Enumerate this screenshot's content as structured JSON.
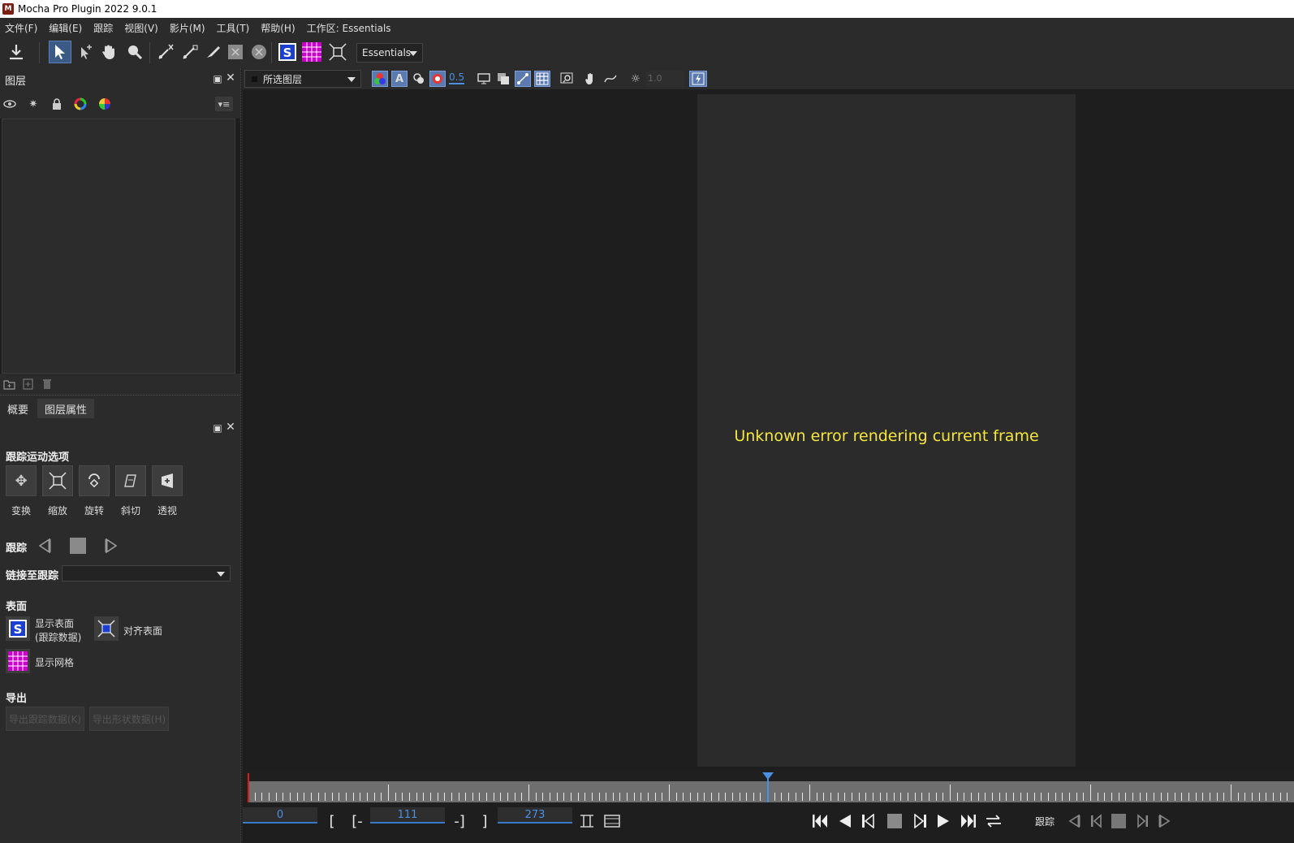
{
  "window": {
    "title": "Mocha Pro Plugin 2022 9.0.1",
    "app_icon_glyph": "M"
  },
  "menu": [
    "文件(F)",
    "编辑(E)",
    "跟踪",
    "视图(V)",
    "影片(M)",
    "工具(T)",
    "帮助(H)",
    "工作区: Essentials"
  ],
  "toolbar": {
    "workspace_value": "Essentials"
  },
  "layers_panel": {
    "title": "图层"
  },
  "tabs": [
    {
      "label": "概要"
    },
    {
      "label": "图层属性"
    }
  ],
  "view_toolbar": {
    "layer_select": "所选图层",
    "opacity": "0.5",
    "brightness": "1.0"
  },
  "props": {
    "track_motion_heading": "跟踪运动选项",
    "motion_buttons": [
      "变换",
      "缩放",
      "旋转",
      "斜切",
      "透视"
    ],
    "track_heading": "跟踪",
    "link_label": "链接至跟踪",
    "link_value": "",
    "surface_heading": "表面",
    "show_surface_line1": "显示表面",
    "show_surface_line2": "(跟踪数据)",
    "align_surface": "对齐表面",
    "show_grid": "显示网格",
    "export_heading": "导出",
    "export_track": "导出跟踪数据(K)",
    "export_shape": "导出形状数据(H)"
  },
  "viewer": {
    "error_message": "Unknown error rendering current frame"
  },
  "transport": {
    "current_frame": "0",
    "bracket_open": "[",
    "in_point_prefix": "[-",
    "in_point": "111",
    "out_point_suffix": "-]",
    "bracket_close": "]",
    "out_point": "273",
    "track_label": "跟踪"
  },
  "colors": {
    "accent": "#4a90e2",
    "error_text": "#f5e63c",
    "grid_magenta": "#cc00cc",
    "surface_blue": "#1a3fd0"
  }
}
